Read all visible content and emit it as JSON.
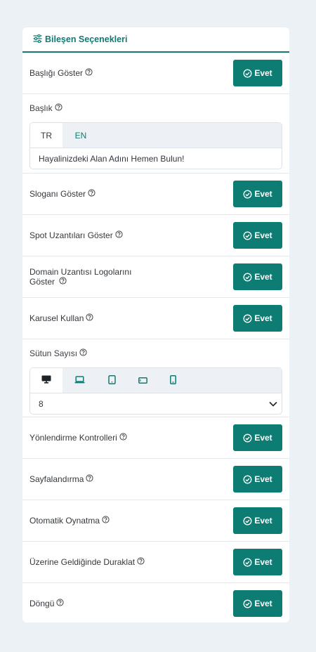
{
  "panel": {
    "title": "Bileşen Seçenekleri"
  },
  "toggle_label": "Evet",
  "rows": {
    "show_title": "Başlığı Göster",
    "title": "Başlık",
    "show_slogan": "Sloganı Göster",
    "spot_ext": "Spot Uzantıları Göster",
    "domain_logos_l1": "Domain Uzantısı Logolarını",
    "domain_logos_l2": "Göster",
    "carousel": "Karusel Kullan",
    "columns": "Sütun Sayısı",
    "nav_controls": "Yönlendirme Kontrolleri",
    "pagination": "Sayfalandırma",
    "autoplay": "Otomatik Oynatma",
    "pause_hover": "Üzerine Geldiğinde Duraklat",
    "loop": "Döngü"
  },
  "title_tabs": {
    "tr": "TR",
    "en": "EN",
    "value": "Hayalinizdeki Alan Adını Hemen Bulun!"
  },
  "columns_select": {
    "value": "8"
  },
  "colors": {
    "accent": "#0d7c72",
    "background": "#ecf1f5"
  }
}
